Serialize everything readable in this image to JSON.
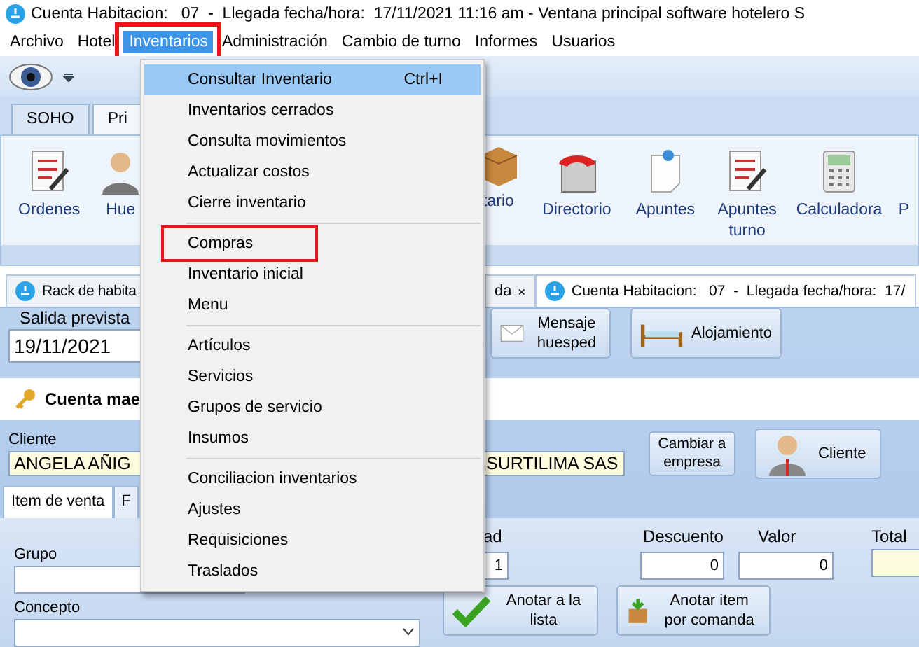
{
  "window": {
    "title": "Cuenta Habitacion:   07  -  Llegada fecha/hora:  17/11/2021 11:16 am - Ventana principal software hotelero S"
  },
  "menu_bar": [
    {
      "label": "Archivo",
      "selected": false,
      "outlined": false
    },
    {
      "label": "Hotel",
      "selected": false,
      "outlined": false
    },
    {
      "label": "Inventarios",
      "selected": true,
      "outlined": true
    },
    {
      "label": "Administración",
      "selected": false,
      "outlined": false
    },
    {
      "label": "Cambio de turno",
      "selected": false,
      "outlined": false
    },
    {
      "label": "Informes",
      "selected": false,
      "outlined": false
    },
    {
      "label": "Usuarios",
      "selected": false,
      "outlined": false
    }
  ],
  "dropdown": [
    {
      "label": "Consultar Inventario",
      "shortcut": "Ctrl+I",
      "highlighted": true,
      "outlined": false,
      "separator_before": false
    },
    {
      "label": "Inventarios cerrados",
      "highlighted": false,
      "outlined": false,
      "separator_before": false
    },
    {
      "label": "Consulta movimientos",
      "highlighted": false,
      "outlined": false,
      "separator_before": false
    },
    {
      "label": "Actualizar costos",
      "highlighted": false,
      "outlined": false,
      "separator_before": false
    },
    {
      "label": "Cierre inventario",
      "highlighted": false,
      "outlined": false,
      "separator_before": false
    },
    {
      "label": "Compras",
      "highlighted": false,
      "outlined": true,
      "separator_before": true
    },
    {
      "label": "Inventario inicial",
      "highlighted": false,
      "outlined": false,
      "separator_before": false
    },
    {
      "label": "Menu",
      "highlighted": false,
      "outlined": false,
      "separator_before": false
    },
    {
      "label": "Artículos",
      "highlighted": false,
      "outlined": false,
      "separator_before": true
    },
    {
      "label": "Servicios",
      "highlighted": false,
      "outlined": false,
      "separator_before": false
    },
    {
      "label": "Grupos de servicio",
      "highlighted": false,
      "outlined": false,
      "separator_before": false
    },
    {
      "label": "Insumos",
      "highlighted": false,
      "outlined": false,
      "separator_before": false
    },
    {
      "label": "Conciliacion inventarios",
      "highlighted": false,
      "outlined": false,
      "separator_before": true
    },
    {
      "label": "Ajustes",
      "highlighted": false,
      "outlined": false,
      "separator_before": false
    },
    {
      "label": "Requisiciones",
      "highlighted": false,
      "outlined": false,
      "separator_before": false
    },
    {
      "label": "Traslados",
      "highlighted": false,
      "outlined": false,
      "separator_before": false
    }
  ],
  "ribbon_tabs": [
    {
      "label": "SOHO",
      "selected": false
    },
    {
      "label": "Pri",
      "selected": true
    }
  ],
  "ribbon_buttons": [
    {
      "label": "Ordenes",
      "kind": "checklist"
    },
    {
      "label": "Hue",
      "kind": "person"
    },
    {
      "label": "tario",
      "kind": "box"
    },
    {
      "label": "Directorio",
      "kind": "phone"
    },
    {
      "label": "Apuntes",
      "kind": "note"
    },
    {
      "label": "Apuntes turno",
      "kind": "checklist"
    },
    {
      "label": "Calculadora",
      "kind": "calculator"
    },
    {
      "label": "P",
      "kind": "none"
    }
  ],
  "document_tabs": [
    {
      "label": "Rack de habita",
      "selected": false
    },
    {
      "label": "da",
      "selected": false,
      "closable": true
    },
    {
      "label": "Cuenta Habitacion:   07  -  Llegada fecha/hora:  17/",
      "selected": true
    }
  ],
  "stay": {
    "departure_label": "Salida prevista",
    "departure_date": "19/11/2021",
    "message_button": "Mensaje huesped",
    "lodging_button": "Alojamiento"
  },
  "account": {
    "title": "Cuenta mae"
  },
  "client": {
    "label": "Cliente",
    "name_left": "ANGELA AÑIG",
    "name_right": "SURTILIMA SAS",
    "change_button": "Cambiar a empresa",
    "client_button": "Cliente"
  },
  "item_tabs": [
    {
      "label": "Item de venta",
      "selected": true
    },
    {
      "label": "F",
      "selected": false
    }
  ],
  "item_form": {
    "group_label": "Grupo",
    "concept_label": "Concepto",
    "quantity_label": "ad",
    "quantity": "1",
    "discount_label": "Descuento",
    "discount": "0",
    "value_label": "Valor",
    "value": "0",
    "total_label": "Total",
    "add_button": "Anotar a la lista",
    "order_button": "Anotar item por comanda"
  }
}
